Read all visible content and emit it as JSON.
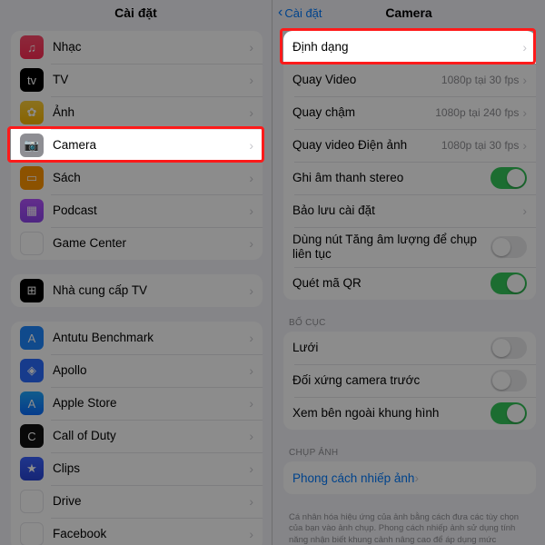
{
  "left": {
    "title": "Cài đặt",
    "groups": [
      [
        {
          "icon": "music-icon",
          "cls": "ic-music",
          "glyph": "♫",
          "label": "Nhạc"
        },
        {
          "icon": "tv-icon",
          "cls": "ic-tv",
          "glyph": "tv",
          "label": "TV"
        },
        {
          "icon": "photos-icon",
          "cls": "ic-photo",
          "glyph": "✿",
          "label": "Ảnh"
        },
        {
          "icon": "camera-icon",
          "cls": "ic-camera",
          "glyph": "📷",
          "label": "Camera",
          "highlight": true
        },
        {
          "icon": "books-icon",
          "cls": "ic-books",
          "glyph": "▭",
          "label": "Sách"
        },
        {
          "icon": "podcast-icon",
          "cls": "ic-podcast",
          "glyph": "▦",
          "label": "Podcast"
        },
        {
          "icon": "gamecenter-icon",
          "cls": "ic-gc",
          "glyph": "●●",
          "label": "Game Center"
        }
      ],
      [
        {
          "icon": "tvprovider-icon",
          "cls": "ic-tvprov",
          "glyph": "⊞",
          "label": "Nhà cung cấp TV"
        }
      ],
      [
        {
          "icon": "antutu-icon",
          "cls": "ic-antutu",
          "glyph": "A",
          "label": "Antutu Benchmark"
        },
        {
          "icon": "apollo-icon",
          "cls": "ic-apollo",
          "glyph": "◈",
          "label": "Apollo"
        },
        {
          "icon": "appstore-icon",
          "cls": "ic-appstore",
          "glyph": "A",
          "label": "Apple Store"
        },
        {
          "icon": "cod-icon",
          "cls": "ic-cod",
          "glyph": "C",
          "label": "Call of Duty"
        },
        {
          "icon": "clips-icon",
          "cls": "ic-clips",
          "glyph": "★",
          "label": "Clips"
        },
        {
          "icon": "drive-icon",
          "cls": "ic-drive",
          "glyph": "▲",
          "label": "Drive"
        },
        {
          "icon": "fb-icon",
          "cls": "ic-fb",
          "glyph": "f",
          "label": "Facebook"
        }
      ]
    ]
  },
  "right": {
    "back": "Cài đặt",
    "title": "Camera",
    "groups": [
      {
        "rows": [
          {
            "label": "Định dạng",
            "type": "chevron",
            "highlight": true
          },
          {
            "label": "Quay Video",
            "type": "value-chevron",
            "value": "1080p tại 30 fps"
          },
          {
            "label": "Quay chậm",
            "type": "value-chevron",
            "value": "1080p tại 240 fps"
          },
          {
            "label": "Quay video Điện ảnh",
            "type": "value-chevron",
            "value": "1080p tại 30 fps"
          },
          {
            "label": "Ghi âm thanh stereo",
            "type": "toggle",
            "on": true
          },
          {
            "label": "Bảo lưu cài đặt",
            "type": "chevron"
          },
          {
            "label": "Dùng nút Tăng âm lượng để chụp liên tục",
            "type": "toggle",
            "on": false,
            "tall": true
          },
          {
            "label": "Quét mã QR",
            "type": "toggle",
            "on": true
          }
        ]
      },
      {
        "header": "BỐ CỤC",
        "rows": [
          {
            "label": "Lưới",
            "type": "toggle",
            "on": false
          },
          {
            "label": "Đối xứng camera trước",
            "type": "toggle",
            "on": false
          },
          {
            "label": "Xem bên ngoài khung hình",
            "type": "toggle",
            "on": true
          }
        ]
      },
      {
        "header": "CHỤP ẢNH",
        "rows": [
          {
            "label": "Phong cách nhiếp ảnh",
            "type": "link-chevron"
          }
        ],
        "footer": "Cá nhân hóa hiệu ứng của ảnh bằng cách đưa các tùy chọn của bạn vào ảnh chụp. Phong cách nhiếp ảnh sử dụng tính năng nhận biết khung cảnh nâng cao để áp dụng mức"
      }
    ]
  }
}
